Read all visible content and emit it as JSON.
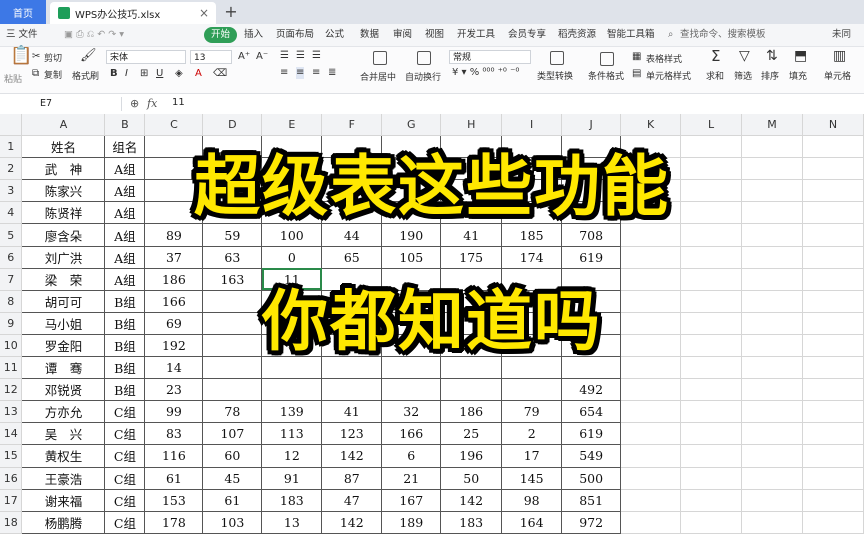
{
  "tabs": {
    "home": "首页",
    "file": "WPS办公技巧.xlsx",
    "add": "+",
    "close": "×"
  },
  "menu": {
    "file": "三 文件",
    "items": [
      "开始",
      "插入",
      "页面布局",
      "公式",
      "数据",
      "审阅",
      "视图",
      "开发工具",
      "会员专享",
      "稻壳资源",
      "智能工具箱"
    ],
    "search": "查找命令、搜索模板",
    "cloud": "未同"
  },
  "ribbon": {
    "cut": "剪切",
    "copy": "复制",
    "paste": "粘贴",
    "format_painter": "格式刷",
    "font": "宋体",
    "size": "13",
    "merge": "合并居中",
    "wrap": "自动换行",
    "number_format": "常规",
    "type_convert": "类型转换",
    "table_style": "表格样式",
    "cond_format": "条件格式",
    "cell_style": "单元格样式",
    "sum": "求和",
    "filter": "筛选",
    "sort": "排序",
    "fill": "填充",
    "cell": "单元格"
  },
  "formula_bar": {
    "cell_ref": "E7",
    "fx": "fx",
    "value": "11"
  },
  "sheet": {
    "columns": [
      "A",
      "B",
      "C",
      "D",
      "E",
      "F",
      "G",
      "H",
      "I",
      "J",
      "K",
      "L",
      "M",
      "N"
    ],
    "rows": [
      [
        "姓名",
        "组名",
        "",
        "",
        "",
        "",
        "",
        "",
        "",
        "",
        "",
        "",
        "",
        ""
      ],
      [
        "武　神",
        "A组",
        "",
        "",
        "",
        "",
        "",
        "",
        "",
        "",
        "",
        "",
        "",
        ""
      ],
      [
        "陈家兴",
        "A组",
        "",
        "",
        "",
        "",
        "",
        "",
        "",
        "",
        "",
        "",
        "",
        ""
      ],
      [
        "陈贤祥",
        "A组",
        "",
        "",
        "",
        "",
        "",
        "",
        "",
        "",
        "",
        "",
        "",
        ""
      ],
      [
        "廖含朵",
        "A组",
        "89",
        "59",
        "100",
        "44",
        "190",
        "41",
        "185",
        "708",
        "",
        "",
        "",
        ""
      ],
      [
        "刘广洪",
        "A组",
        "37",
        "63",
        "0",
        "65",
        "105",
        "175",
        "174",
        "619",
        "",
        "",
        "",
        ""
      ],
      [
        "梁　荣",
        "A组",
        "186",
        "163",
        "11",
        "",
        "",
        "",
        "",
        "",
        "",
        "",
        "",
        ""
      ],
      [
        "胡可可",
        "B组",
        "166",
        "",
        "",
        "",
        "",
        "",
        "",
        "",
        "",
        "",
        "",
        ""
      ],
      [
        "马小姐",
        "B组",
        "69",
        "",
        "",
        "",
        "",
        "",
        "",
        "",
        "",
        "",
        "",
        ""
      ],
      [
        "罗金阳",
        "B组",
        "192",
        "",
        "",
        "",
        "",
        "",
        "",
        "",
        "",
        "",
        "",
        ""
      ],
      [
        "谭　骞",
        "B组",
        "14",
        "",
        "",
        "",
        "",
        "",
        "",
        "",
        "",
        "",
        "",
        ""
      ],
      [
        "邓锐贤",
        "B组",
        "23",
        "",
        "",
        "",
        "",
        "",
        "",
        "492",
        "",
        "",
        "",
        ""
      ],
      [
        "方亦允",
        "C组",
        "99",
        "78",
        "139",
        "41",
        "32",
        "186",
        "79",
        "654",
        "",
        "",
        "",
        ""
      ],
      [
        "吴　兴",
        "C组",
        "83",
        "107",
        "113",
        "123",
        "166",
        "25",
        "2",
        "619",
        "",
        "",
        "",
        ""
      ],
      [
        "黄权生",
        "C组",
        "116",
        "60",
        "12",
        "142",
        "6",
        "196",
        "17",
        "549",
        "",
        "",
        "",
        ""
      ],
      [
        "王豪浩",
        "C组",
        "61",
        "45",
        "91",
        "87",
        "21",
        "50",
        "145",
        "500",
        "",
        "",
        "",
        ""
      ],
      [
        "谢来福",
        "C组",
        "153",
        "61",
        "183",
        "47",
        "167",
        "142",
        "98",
        "851",
        "",
        "",
        "",
        ""
      ],
      [
        "杨鹏腾",
        "C组",
        "178",
        "103",
        "13",
        "142",
        "189",
        "183",
        "164",
        "972",
        "",
        "",
        "",
        ""
      ]
    ]
  },
  "overlay": {
    "line1": "超级表这些功能",
    "line2": "你都知道吗"
  },
  "colors": {
    "home_tab": "#3d78e6",
    "start_button": "#2f9e57",
    "overlay_text": "#ffe800",
    "overlay_outline": "#000000"
  }
}
